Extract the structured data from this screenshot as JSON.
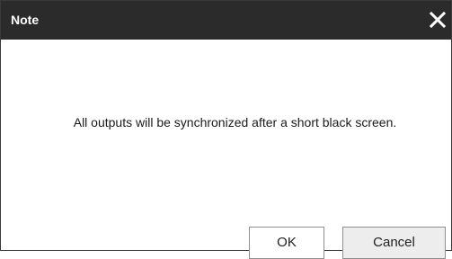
{
  "dialog": {
    "title": "Note",
    "message": "All outputs will be synchronized after a short black screen.",
    "buttons": {
      "ok_label": "OK",
      "cancel_label": "Cancel"
    },
    "close_icon": "close-icon"
  },
  "colors": {
    "titlebar_bg": "#2b2b2b",
    "title_text": "#ffffff",
    "body_bg": "#ffffff",
    "cancel_bg": "#ededed",
    "button_border": "#8f8f8f"
  }
}
